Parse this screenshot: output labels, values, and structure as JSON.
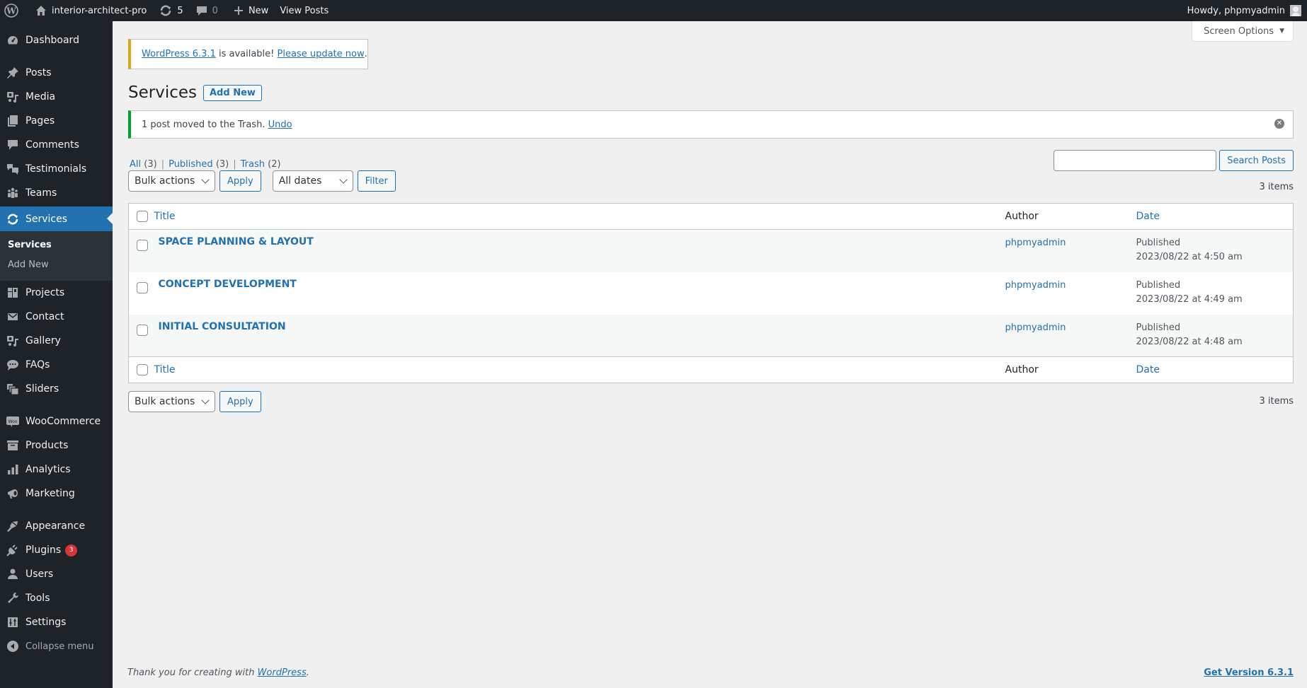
{
  "adminbar": {
    "site_name": "interior-architect-pro",
    "updates_count": "5",
    "comments_count": "0",
    "new_label": "New",
    "view_posts_label": "View Posts",
    "howdy": "Howdy, phpmyadmin"
  },
  "sidebar": {
    "items": [
      {
        "label": "Dashboard",
        "icon": "dashboard-icon"
      },
      {
        "label": "Posts",
        "icon": "pin-icon"
      },
      {
        "label": "Media",
        "icon": "media-icon"
      },
      {
        "label": "Pages",
        "icon": "pages-icon"
      },
      {
        "label": "Comments",
        "icon": "comment-icon"
      },
      {
        "label": "Testimonials",
        "icon": "testimonial-icon"
      },
      {
        "label": "Teams",
        "icon": "groups-icon"
      },
      {
        "label": "Services",
        "icon": "update-icon"
      },
      {
        "label": "Projects",
        "icon": "portfolio-icon"
      },
      {
        "label": "Contact",
        "icon": "email-icon"
      },
      {
        "label": "Gallery",
        "icon": "gallery-icon"
      },
      {
        "label": "FAQs",
        "icon": "format-chat-icon"
      },
      {
        "label": "Sliders",
        "icon": "slides-icon"
      },
      {
        "label": "WooCommerce",
        "icon": "woo-icon"
      },
      {
        "label": "Products",
        "icon": "archive-icon"
      },
      {
        "label": "Analytics",
        "icon": "chart-bar-icon"
      },
      {
        "label": "Marketing",
        "icon": "megaphone-icon"
      },
      {
        "label": "Appearance",
        "icon": "brush-icon"
      },
      {
        "label": "Plugins",
        "icon": "plugin-icon",
        "badge": "3"
      },
      {
        "label": "Users",
        "icon": "user-icon"
      },
      {
        "label": "Tools",
        "icon": "wrench-icon"
      },
      {
        "label": "Settings",
        "icon": "settings-icon"
      }
    ],
    "submenu": [
      "Services",
      "Add New"
    ],
    "collapse_label": "Collapse menu"
  },
  "screen_options": "Screen Options",
  "update_notice": {
    "version_link": "WordPress 6.3.1",
    "middle": " is available! ",
    "update_link": "Please update now",
    "end": "."
  },
  "page": {
    "title": "Services",
    "add_new": "Add New"
  },
  "trash_notice": {
    "text": "1 post moved to the Trash. ",
    "undo": "Undo"
  },
  "filters": {
    "all": "All",
    "all_count": "(3)",
    "published": "Published",
    "published_count": "(3)",
    "trash": "Trash",
    "trash_count": "(2)"
  },
  "search": {
    "value": "",
    "button": "Search Posts"
  },
  "tablenav": {
    "bulk_actions": "Bulk actions",
    "apply": "Apply",
    "all_dates": "All dates",
    "filter": "Filter",
    "items_count": "3 items"
  },
  "table": {
    "columns": {
      "title": "Title",
      "author": "Author",
      "date": "Date"
    },
    "rows": [
      {
        "title": "SPACE PLANNING & LAYOUT",
        "author": "phpmyadmin",
        "status": "Published",
        "date": "2023/08/22 at 4:50 am"
      },
      {
        "title": "CONCEPT DEVELOPMENT",
        "author": "phpmyadmin",
        "status": "Published",
        "date": "2023/08/22 at 4:49 am"
      },
      {
        "title": "INITIAL CONSULTATION",
        "author": "phpmyadmin",
        "status": "Published",
        "date": "2023/08/22 at 4:48 am"
      }
    ]
  },
  "footer": {
    "thanks": "Thank you for creating with ",
    "wp_link": "WordPress",
    "period": ".",
    "version_link": "Get Version 6.3.1"
  },
  "colors": {
    "accent": "#2271b1",
    "adminbar_bg": "#1d2327",
    "success": "#00a32a",
    "warning": "#dba617",
    "badge": "#d63638"
  }
}
